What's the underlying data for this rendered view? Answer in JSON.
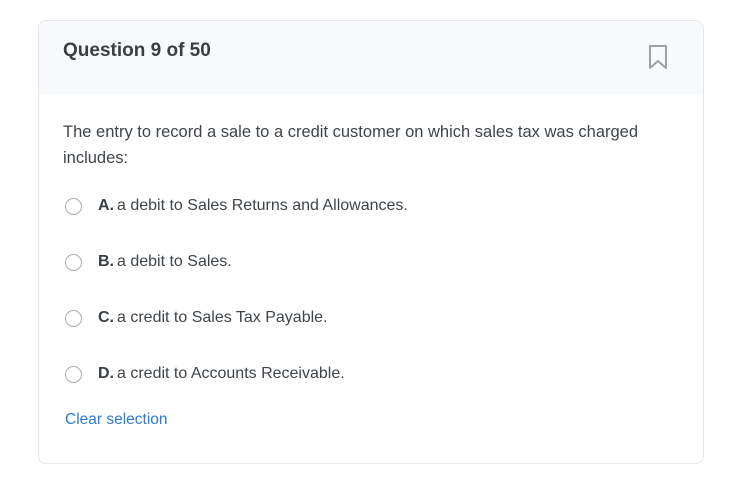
{
  "question": {
    "title": "Question 9 of 50",
    "text": "The entry to record a sale to a credit customer on which sales tax was charged includes:"
  },
  "options": [
    {
      "letter": "A.",
      "text": "a debit to Sales Returns and Allowances.",
      "selected": false
    },
    {
      "letter": "B.",
      "text": "a debit to Sales.",
      "selected": false
    },
    {
      "letter": "C.",
      "text": "a credit to Sales Tax Payable.",
      "selected": false
    },
    {
      "letter": "D.",
      "text": "a credit to Accounts Receivable.",
      "selected": false
    }
  ],
  "actions": {
    "clear_label": "Clear selection"
  },
  "icons": {
    "bookmark": "bookmark-icon"
  },
  "colors": {
    "link": "#2b7bd1",
    "header_bg": "#f8f9fa",
    "border": "#e3e6ea"
  }
}
